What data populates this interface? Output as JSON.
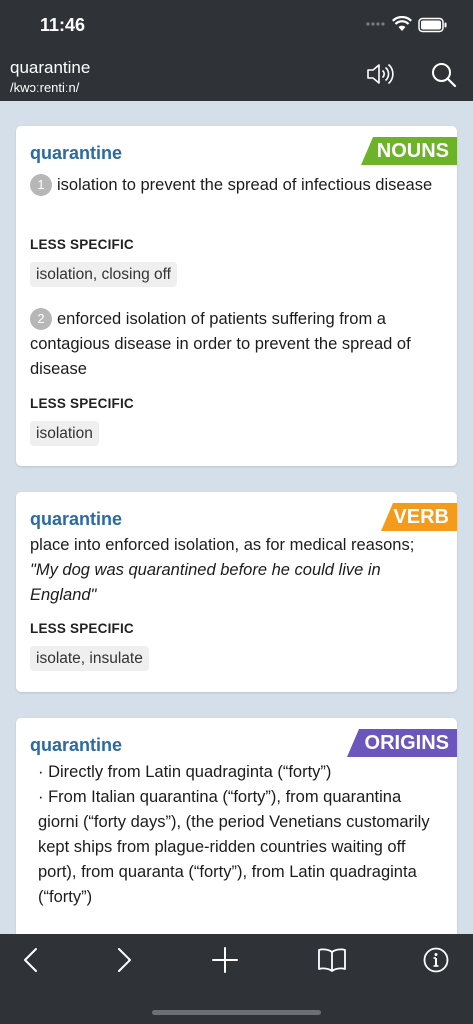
{
  "status": {
    "time": "11:46"
  },
  "header": {
    "word": "quarantine",
    "phonetic": "/kwɔːrentiːn/"
  },
  "labels": {
    "less_specific": "LESS SPECIFIC"
  },
  "cards": {
    "nouns": {
      "word": "quarantine",
      "tag": "NOUNS",
      "tag_color": "#6db32a",
      "senses": [
        {
          "num": "1",
          "definition": "isolation to prevent the spread of infectious disease",
          "related": "isolation, closing off"
        },
        {
          "num": "2",
          "definition": "enforced isolation of patients suffering from a contagious disease in order to prevent the spread of disease",
          "related": "isolation"
        }
      ]
    },
    "verb": {
      "word": "quarantine",
      "tag": "VERB",
      "tag_color": "#f59b1b",
      "definition": "place into enforced isolation, as for medical reasons;",
      "example": "\"My dog was quarantined before he could live in England\"",
      "related": "isolate, insulate"
    },
    "origins": {
      "word": "quarantine",
      "tag": "ORIGINS",
      "tag_color": "#6a56bc",
      "lines": [
        "· Directly from Latin quadraginta (“forty”)",
        "· From Italian quarantina (“forty”), from quarantina giorni (“forty days”), (the period Venetians customarily kept ships from plague-ridden countries waiting off port), from quaranta (“forty”), from Latin quadraginta (“forty”)"
      ]
    }
  },
  "icons": {
    "speaker": "speaker-icon",
    "search": "search-icon",
    "back": "back-arrow-icon",
    "forward": "forward-arrow-icon",
    "add": "plus-icon",
    "book": "book-icon",
    "info": "info-icon"
  }
}
